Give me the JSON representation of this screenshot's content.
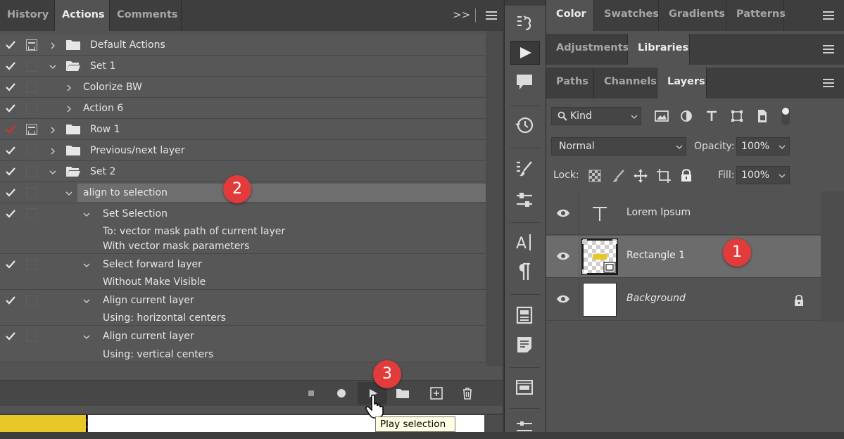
{
  "actions_panel": {
    "tabs": [
      "History",
      "Actions",
      "Comments"
    ],
    "active_tab": "Actions",
    "rows": [
      {
        "type": "set",
        "label": "Default Actions",
        "check": "white",
        "dialog": true,
        "expanded": false
      },
      {
        "type": "set",
        "label": "Set 1",
        "check": "white",
        "dialog": false,
        "expanded": true
      },
      {
        "type": "action",
        "label": "Colorize BW",
        "check": "white",
        "dialog": false,
        "expanded": false
      },
      {
        "type": "action",
        "label": "Action 6",
        "check": "white",
        "dialog": false,
        "expanded": false
      },
      {
        "type": "set",
        "label": "Row 1",
        "check": "red",
        "dialog": true,
        "expanded": false
      },
      {
        "type": "set",
        "label": "Previous/next layer",
        "check": "white",
        "dialog": false,
        "expanded": false
      },
      {
        "type": "set",
        "label": "Set 2",
        "check": "white",
        "dialog": false,
        "expanded": true
      },
      {
        "type": "action",
        "label": "align to selection",
        "check": "white",
        "dialog": false,
        "expanded": true,
        "selected": true
      },
      {
        "type": "step",
        "label": "Set Selection",
        "details": [
          "To: vector mask path of current layer",
          "With vector mask parameters"
        ]
      },
      {
        "type": "step",
        "label": "Select forward layer",
        "details": [
          "Without Make Visible"
        ]
      },
      {
        "type": "step",
        "label": "Align current layer",
        "details": [
          "Using: horizontal centers"
        ]
      },
      {
        "type": "step",
        "label": "Align current layer",
        "details": [
          "Using: vertical centers"
        ]
      }
    ],
    "tooltip": "Play selection"
  },
  "right_panel": {
    "tab_groups": [
      {
        "tabs": [
          "Color",
          "Swatches",
          "Gradients",
          "Patterns"
        ],
        "active": "Color"
      },
      {
        "tabs": [
          "Adjustments",
          "Libraries"
        ],
        "active": "Libraries"
      },
      {
        "tabs": [
          "Paths",
          "Channels",
          "Layers"
        ],
        "active": "Layers"
      }
    ],
    "filter_kind": "Kind",
    "blend_mode": "Normal",
    "opacity_label": "Opacity:",
    "opacity_value": "100%",
    "lock_label": "Lock:",
    "fill_label": "Fill:",
    "fill_value": "100%",
    "layers": [
      {
        "name": "Lorem Ipsum",
        "kind": "text",
        "selected": false,
        "italic": false,
        "locked": false
      },
      {
        "name": "Rectangle 1",
        "kind": "shape",
        "selected": true,
        "italic": false,
        "locked": false
      },
      {
        "name": "Background",
        "kind": "fill",
        "selected": false,
        "italic": true,
        "locked": true
      }
    ]
  },
  "badges": [
    "2",
    "1",
    "3"
  ],
  "colors": {
    "accent_red": "#e23b3b",
    "check_red": "#e02b2b",
    "yellow": "#e8c829"
  }
}
